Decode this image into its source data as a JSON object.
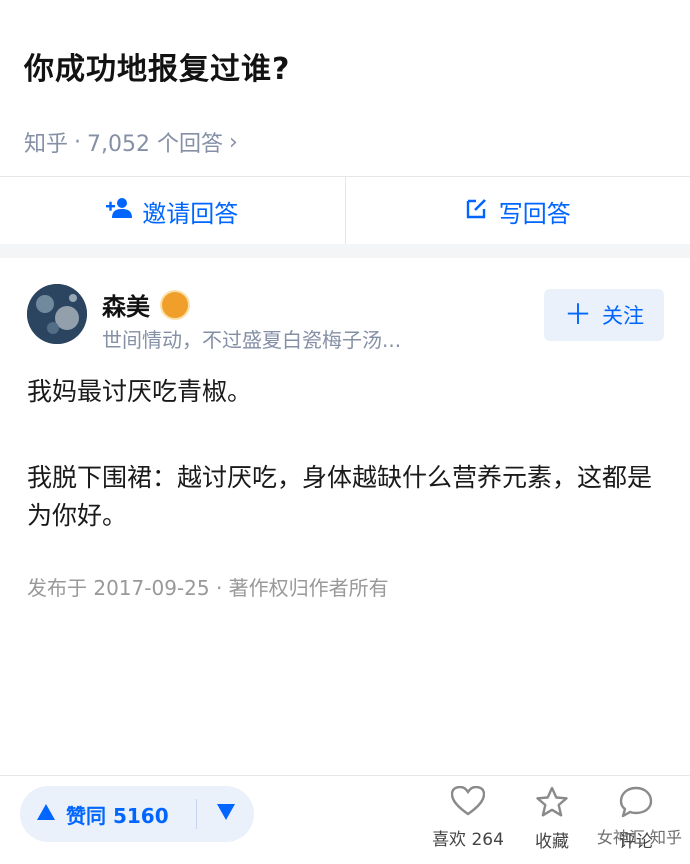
{
  "question": {
    "title": "你成功地报复过谁?",
    "source": "知乎",
    "separator": "·",
    "answers_count": "7,052 个回答",
    "chevron": "›"
  },
  "actions": {
    "invite_label": "邀请回答",
    "write_label": "写回答"
  },
  "answer": {
    "author_name": "森美",
    "author_bio": "世间情动，不过盛夏白瓷梅子汤...",
    "follow_label": "关注",
    "paragraphs": [
      "我妈最讨厌吃青椒。",
      "我脱下围裙：越讨厌吃，身体越缺什么营养元素，这都是为你好。"
    ],
    "published": "发布于 2017-09-25 · 著作权归作者所有"
  },
  "bottom_bar": {
    "vote_label": "赞同 5160",
    "like_label": "喜欢 264",
    "collect_label": "收藏",
    "comment_label": "评论"
  },
  "watermark": "女神汇 知乎",
  "colors": {
    "accent": "#0066ff",
    "muted": "#8590a6"
  },
  "icons": [
    "invite-person-icon",
    "edit-icon",
    "verified-badge-icon",
    "plus-icon",
    "upvote-triangle-icon",
    "downvote-triangle-icon",
    "heart-icon",
    "star-icon",
    "comment-bubble-icon"
  ]
}
